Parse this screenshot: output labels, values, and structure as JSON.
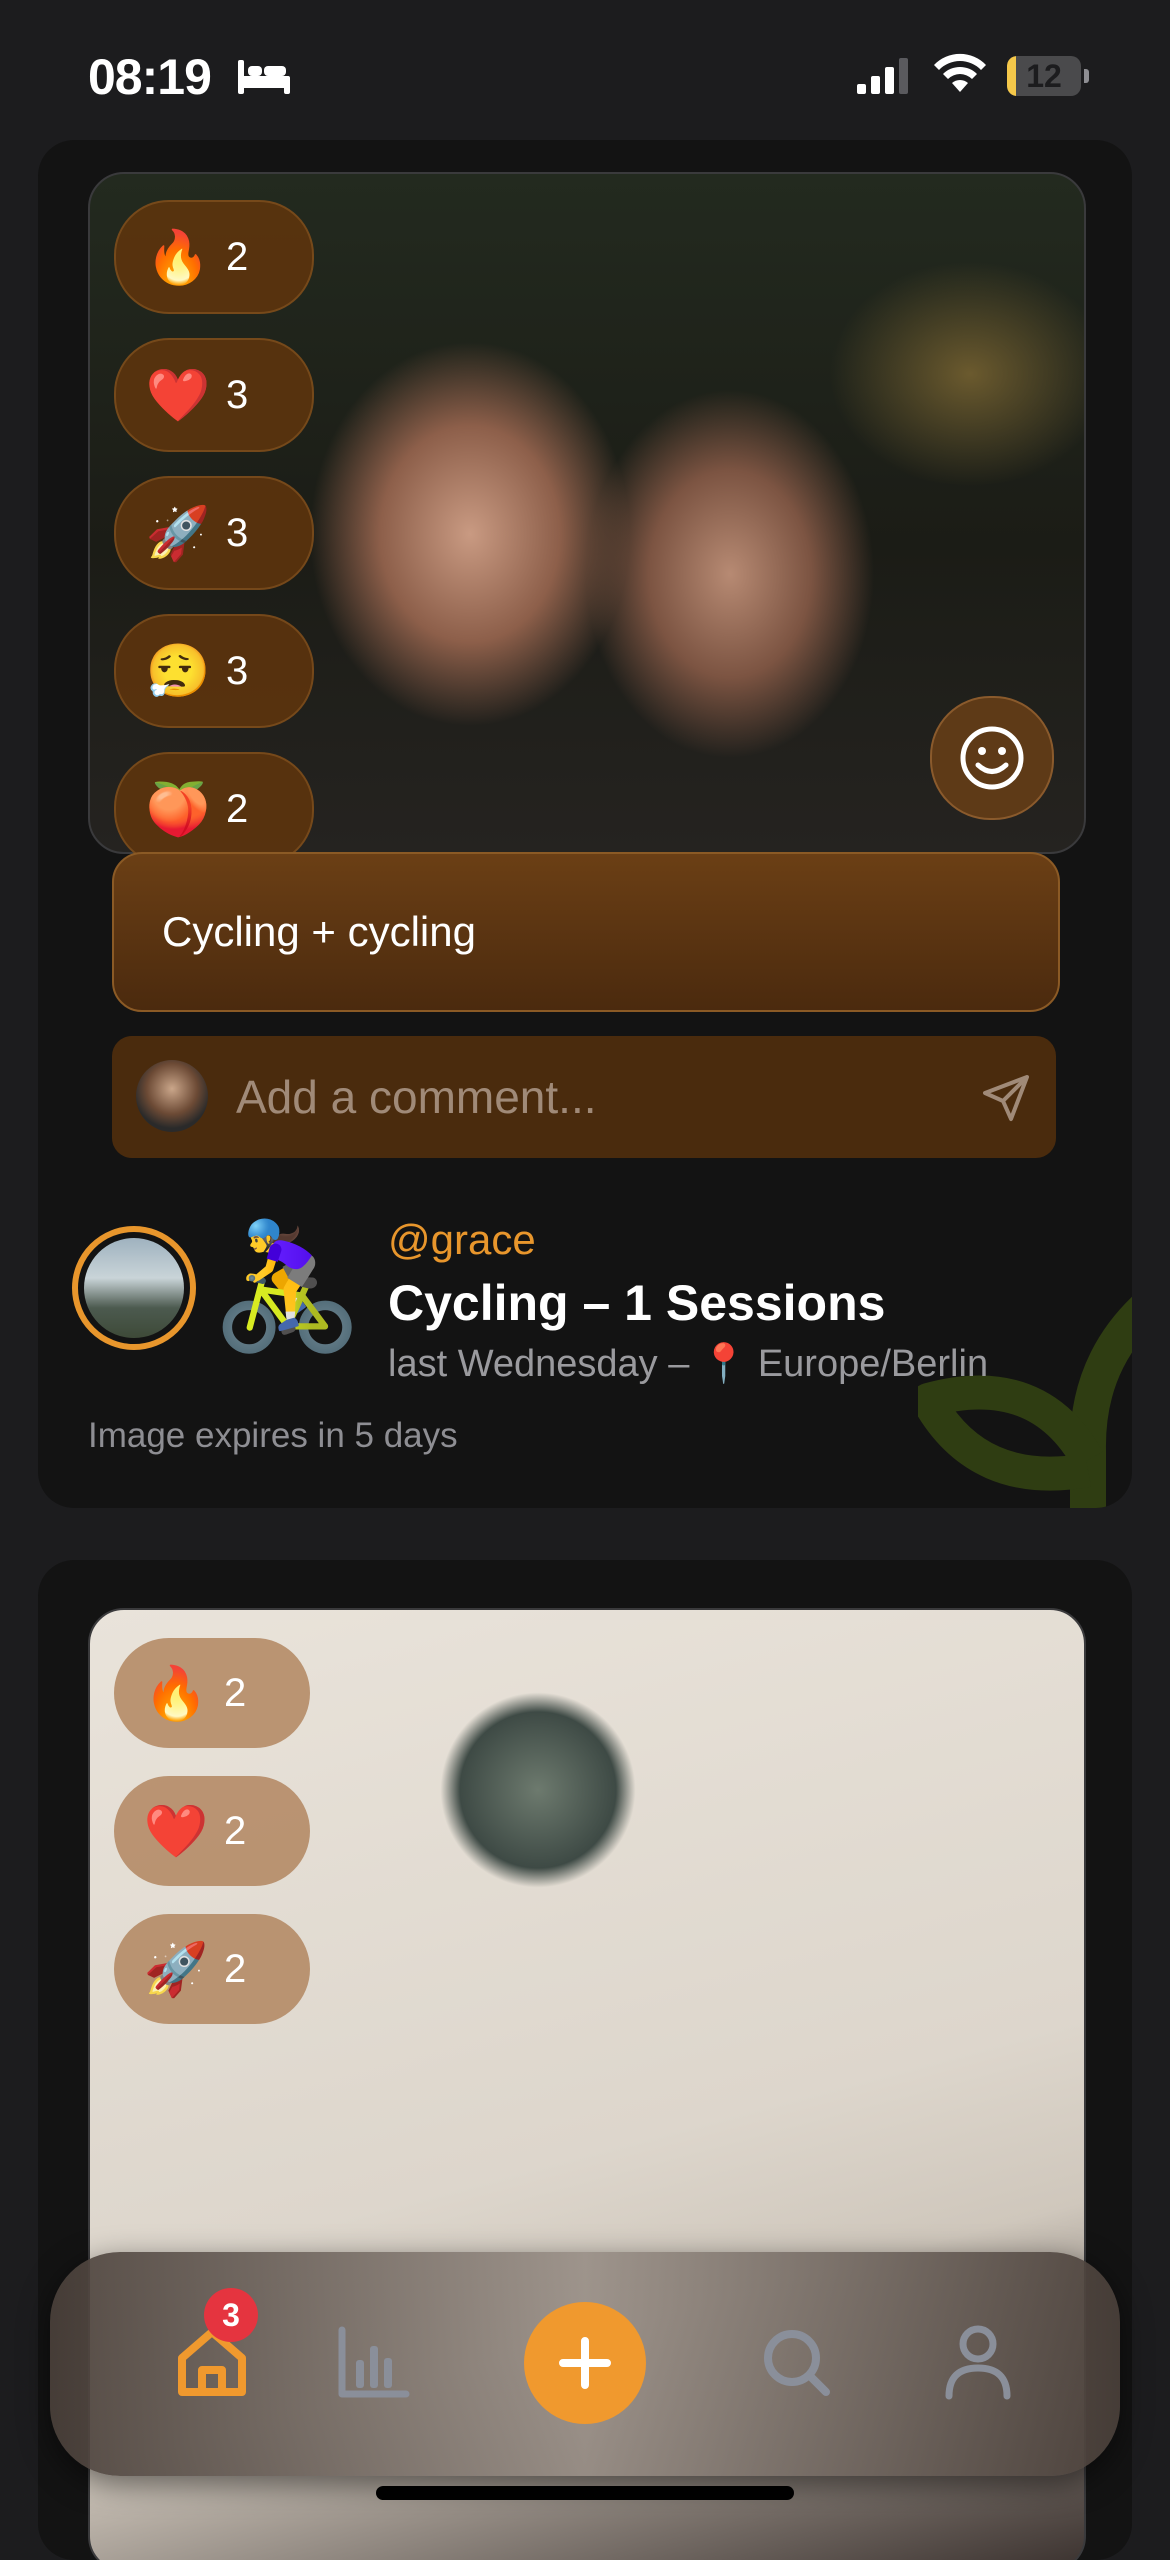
{
  "status_bar": {
    "time": "08:19",
    "battery": "12",
    "battery_level": 0.12
  },
  "posts": [
    {
      "reactions": [
        {
          "emoji": "🔥",
          "count": "2"
        },
        {
          "emoji": "❤️",
          "count": "3"
        },
        {
          "emoji": "🚀",
          "count": "3"
        },
        {
          "emoji": "😮‍💨",
          "count": "3"
        },
        {
          "emoji": "🍑",
          "count": "2"
        }
      ],
      "caption": "Cycling + cycling",
      "comment_placeholder": "Add a comment...",
      "username": "@grace",
      "activity_emoji": "🚴‍♀️",
      "title": "Cycling – 1 Sessions",
      "when": "last Wednesday –",
      "location_pin": "📍",
      "location": "Europe/Berlin",
      "expiry": "Image expires in 5 days"
    },
    {
      "reactions": [
        {
          "emoji": "🔥",
          "count": "2"
        },
        {
          "emoji": "❤️",
          "count": "2"
        },
        {
          "emoji": "🚀",
          "count": "2"
        }
      ]
    }
  ],
  "tab_bar": {
    "home_badge": "3",
    "active_tab": "home",
    "accent_color": "#f0992e"
  }
}
